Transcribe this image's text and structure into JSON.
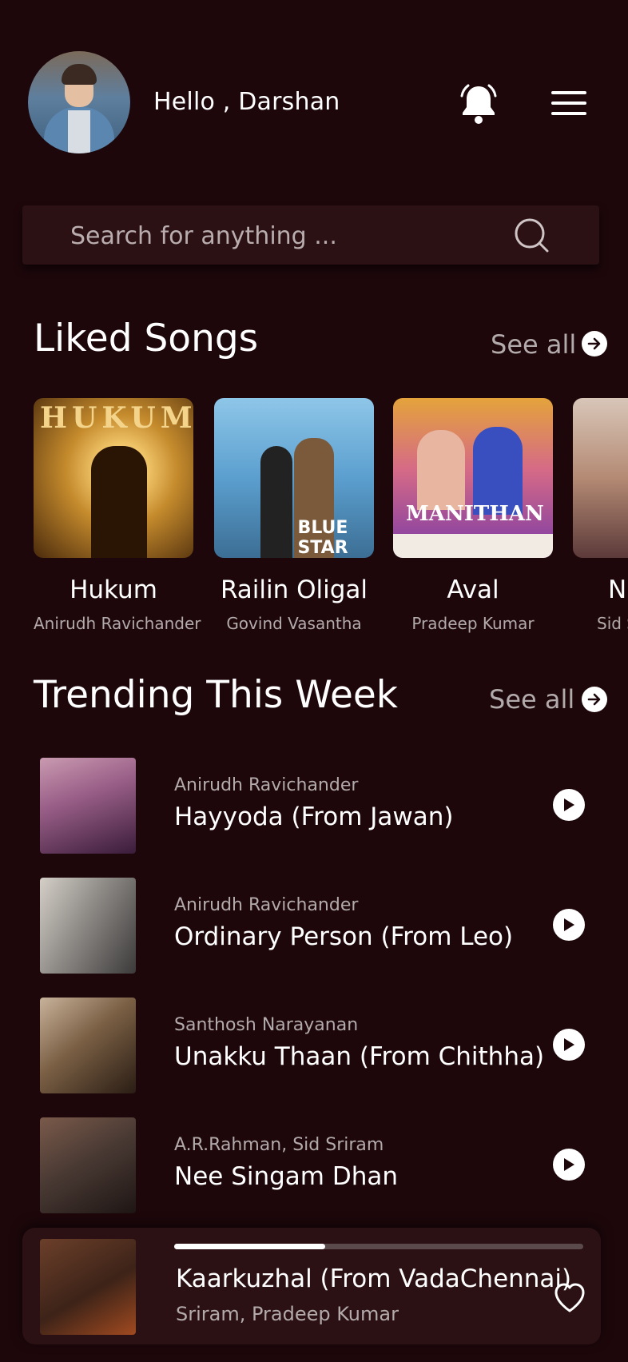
{
  "header": {
    "greeting": "Hello , Darshan",
    "user_name": "Darshan"
  },
  "search": {
    "placeholder": "Search for anything ..."
  },
  "liked_songs": {
    "heading": "Liked Songs",
    "see_all": "See all",
    "items": [
      {
        "title": "Hukum",
        "artist": "Anirudh Ravichander",
        "cover_text": "HUKUM"
      },
      {
        "title": "Railin Oligal",
        "artist": "Govind Vasantha",
        "cover_text": "BLUE STAR"
      },
      {
        "title": "Aval",
        "artist": "Pradeep Kumar",
        "cover_text": "MANITHAN"
      },
      {
        "title": "N",
        "artist": "Sid S"
      }
    ]
  },
  "trending": {
    "heading": "Trending This Week",
    "see_all": "See all",
    "items": [
      {
        "artist": "Anirudh Ravichander",
        "song": "Hayyoda (From Jawan)"
      },
      {
        "artist": "Anirudh Ravichander",
        "song": "Ordinary Person (From Leo)"
      },
      {
        "artist": "Santhosh Narayanan",
        "song": "Unakku Thaan (From Chithha)"
      },
      {
        "artist": "A.R.Rahman, Sid Sriram",
        "song": "Nee Singam Dhan"
      }
    ]
  },
  "now_playing": {
    "song": "Kaarkuzhal (From VadaChennai)",
    "artist": "Sriram, Pradeep Kumar",
    "progress": 0.37
  },
  "colors": {
    "background": "#1d070b",
    "card": "#2b1114",
    "muted_text": "#b3aaab"
  },
  "icons": [
    "bell-icon",
    "menu-icon",
    "search-icon",
    "arrow-right-icon",
    "play-icon",
    "heart-icon"
  ]
}
